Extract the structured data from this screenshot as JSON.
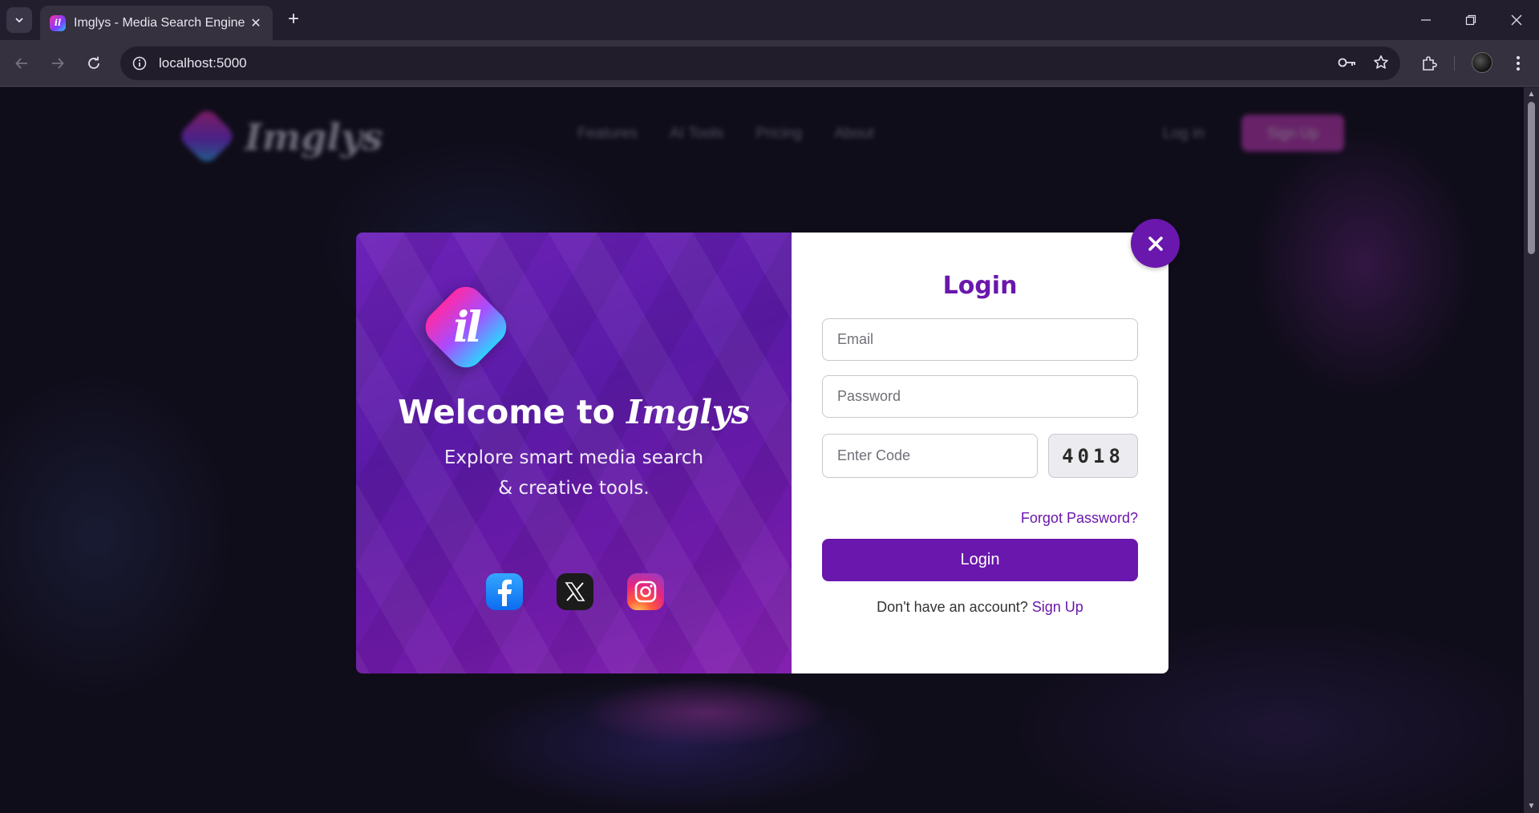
{
  "browser": {
    "tab_title": "Imglys - Media Search Engine",
    "url": "localhost:5000"
  },
  "site": {
    "logo_text": "Imglys",
    "nav": [
      "Features",
      "AI Tools",
      "Pricing",
      "About"
    ],
    "login_label": "Log in",
    "signup_label": "Sign Up"
  },
  "modal": {
    "left": {
      "logo_letters": "il",
      "welcome_prefix": "Welcome to ",
      "welcome_brand": "Imglys",
      "tagline_line1": "Explore smart media search",
      "tagline_line2": "& creative tools."
    },
    "form": {
      "title": "Login",
      "email_placeholder": "Email",
      "password_placeholder": "Password",
      "code_placeholder": "Enter Code",
      "captcha": "4018",
      "forgot": "Forgot Password?",
      "submit": "Login",
      "no_account": "Don't have an account?",
      "signup_link": "Sign Up"
    },
    "close_glyph": "✕"
  },
  "icons": {
    "socials": [
      "facebook-icon",
      "x-icon",
      "instagram-icon"
    ]
  },
  "colors": {
    "accent": "#6a17ad",
    "modal_left": "#5a1aa6",
    "site_signup": "#c83fc0"
  }
}
